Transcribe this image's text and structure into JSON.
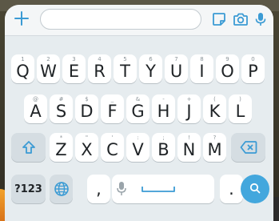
{
  "keyboard": {
    "row1": [
      {
        "hint": "1",
        "label": "Q"
      },
      {
        "hint": "2",
        "label": "W"
      },
      {
        "hint": "3",
        "label": "E"
      },
      {
        "hint": "4",
        "label": "R"
      },
      {
        "hint": "5",
        "label": "T"
      },
      {
        "hint": "6",
        "label": "Y"
      },
      {
        "hint": "7",
        "label": "U"
      },
      {
        "hint": "8",
        "label": "I"
      },
      {
        "hint": "9",
        "label": "O"
      },
      {
        "hint": "0",
        "label": "P"
      }
    ],
    "row2": [
      {
        "hint": "@",
        "label": "A"
      },
      {
        "hint": "#",
        "label": "S"
      },
      {
        "hint": "$",
        "label": "D"
      },
      {
        "hint": "_",
        "label": "F"
      },
      {
        "hint": "&",
        "label": "G"
      },
      {
        "hint": "-",
        "label": "H"
      },
      {
        "hint": "+",
        "label": "J"
      },
      {
        "hint": "(",
        "label": "K"
      },
      {
        "hint": ")",
        "label": "L"
      }
    ],
    "row3": [
      {
        "hint": "*",
        "label": "Z"
      },
      {
        "hint": "\"",
        "label": "X"
      },
      {
        "hint": "'",
        "label": "C"
      },
      {
        "hint": ":",
        "label": "V"
      },
      {
        "hint": ";",
        "label": "B"
      },
      {
        "hint": "!",
        "label": "N"
      },
      {
        "hint": "?",
        "label": "M"
      }
    ],
    "symbols_label": "?123",
    "comma_label": ",",
    "period_label": "."
  },
  "input_bar": {
    "text_value": ""
  },
  "colors": {
    "accent": "#3b9bd4",
    "search_button": "#43a7dd",
    "keyboard_bg": "#e6ecef"
  },
  "icons": {
    "add": "plus-icon",
    "sticker": "sticker-icon",
    "camera": "camera-icon",
    "microphone": "microphone-icon",
    "shift": "shift-arrow-icon",
    "backspace": "backspace-icon",
    "language": "globe-icon",
    "voice": "microphone-icon",
    "search": "search-icon"
  }
}
